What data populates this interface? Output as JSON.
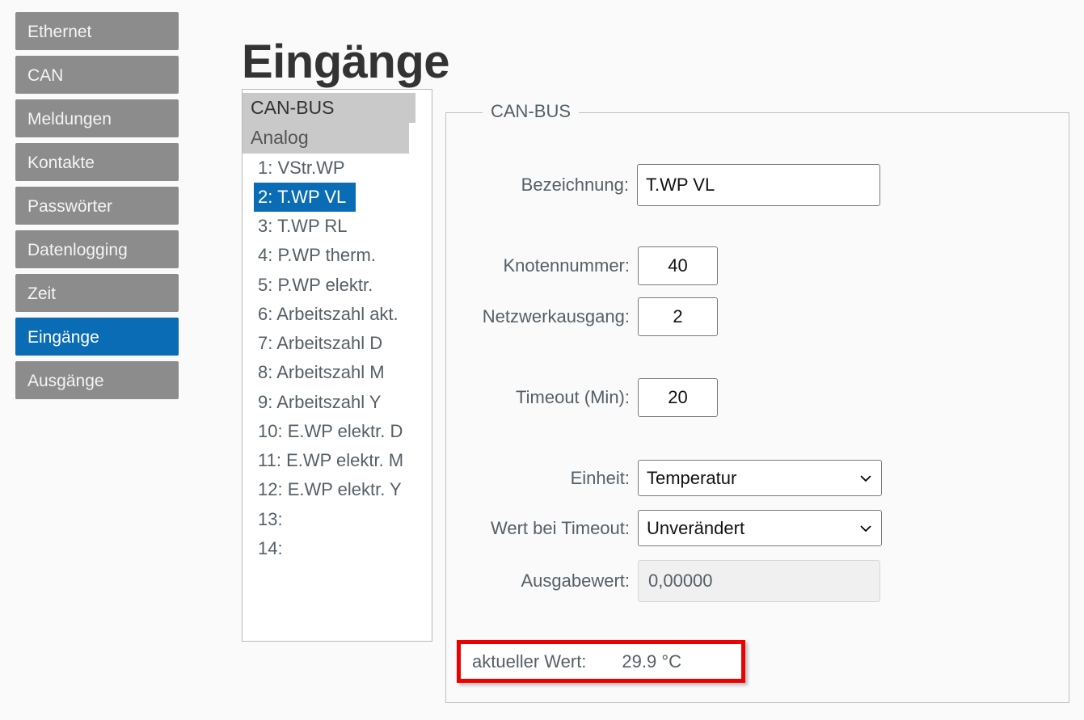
{
  "page": {
    "title": "Eingänge",
    "background_color": "#fafafa",
    "accent_color": "#0a6cb4",
    "nav_color": "#8c8c8c",
    "highlight_color": "#ec0000"
  },
  "sidebar": {
    "items": [
      {
        "label": "Ethernet",
        "active": false
      },
      {
        "label": "CAN",
        "active": false
      },
      {
        "label": "Meldungen",
        "active": false
      },
      {
        "label": "Kontakte",
        "active": false
      },
      {
        "label": "Passwörter",
        "active": false
      },
      {
        "label": "Datenlogging",
        "active": false
      },
      {
        "label": "Zeit",
        "active": false
      },
      {
        "label": "Eingänge",
        "active": true
      },
      {
        "label": "Ausgänge",
        "active": false
      }
    ]
  },
  "list_panel": {
    "group_header": "CAN-BUS",
    "sub_header": "Analog",
    "items": [
      {
        "label": "1: VStr.WP",
        "selected": false
      },
      {
        "label": "2: T.WP VL",
        "selected": true
      },
      {
        "label": "3: T.WP RL",
        "selected": false
      },
      {
        "label": "4: P.WP therm.",
        "selected": false
      },
      {
        "label": "5: P.WP elektr.",
        "selected": false
      },
      {
        "label": "6: Arbeitszahl akt.",
        "selected": false
      },
      {
        "label": "7: Arbeitszahl D",
        "selected": false
      },
      {
        "label": "8: Arbeitszahl M",
        "selected": false
      },
      {
        "label": "9: Arbeitszahl Y",
        "selected": false
      },
      {
        "label": "10: E.WP elektr. D",
        "selected": false
      },
      {
        "label": "11: E.WP elektr. M",
        "selected": false
      },
      {
        "label": "12: E.WP elektr. Y",
        "selected": false
      },
      {
        "label": "13:",
        "selected": false
      },
      {
        "label": "14:",
        "selected": false
      }
    ]
  },
  "form": {
    "legend": "CAN-BUS",
    "bezeichnung": {
      "label": "Bezeichnung:",
      "value": "T.WP VL"
    },
    "knotennummer": {
      "label": "Knotennummer:",
      "value": "40"
    },
    "netzwerkausgang": {
      "label": "Netzwerkausgang:",
      "value": "2"
    },
    "timeout": {
      "label": "Timeout (Min):",
      "value": "20"
    },
    "einheit": {
      "label": "Einheit:",
      "value": "Temperatur",
      "options": [
        "Temperatur"
      ]
    },
    "wert_bei_timeout": {
      "label": "Wert bei Timeout:",
      "value": "Unverändert",
      "options": [
        "Unverändert"
      ]
    },
    "ausgabewert": {
      "label": "Ausgabewert:",
      "value": "0,00000"
    },
    "aktueller_wert": {
      "label": "aktueller Wert:",
      "value": "29.9 °C"
    }
  }
}
